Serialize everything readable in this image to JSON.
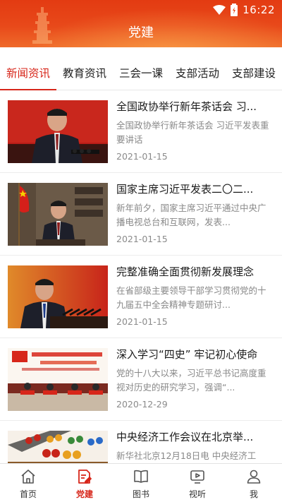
{
  "status_bar": {
    "time": "16:22"
  },
  "header": {
    "title": "党建"
  },
  "tabs": [
    {
      "label": "新闻资讯",
      "active": true
    },
    {
      "label": "教育资讯",
      "active": false
    },
    {
      "label": "三会一课",
      "active": false
    },
    {
      "label": "支部活动",
      "active": false
    },
    {
      "label": "支部建设",
      "active": false
    }
  ],
  "news": [
    {
      "title": "全国政协举行新年茶话会 习...",
      "summary": "全国政协举行新年茶话会 习近平发表重要讲话",
      "date": "2021-01-15"
    },
    {
      "title": "国家主席习近平发表二〇二...",
      "summary": "新年前夕，国家主席习近平通过中央广播电视总台和互联网，发表...",
      "date": "2021-01-15"
    },
    {
      "title": "完整准确全面贯彻新发展理念",
      "summary": "在省部级主要领导干部学习贯彻党的十九届五中全会精神专题研讨...",
      "date": "2021-01-15"
    },
    {
      "title": "深入学习“四史” 牢记初心使命",
      "summary": "党的十八大以来，习近平总书记高度重视对历史的研究学习，强调“...",
      "date": "2020-12-29"
    },
    {
      "title": "中央经济工作会议在北京举...",
      "summary": "新华社北京12月18日电 中央经济工",
      "date": ""
    }
  ],
  "bottom_nav": [
    {
      "label": "首页",
      "icon": "home-icon",
      "active": false
    },
    {
      "label": "党建",
      "icon": "party-building-icon",
      "active": true
    },
    {
      "label": "图书",
      "icon": "book-icon",
      "active": false
    },
    {
      "label": "视听",
      "icon": "video-icon",
      "active": false
    },
    {
      "label": "我",
      "icon": "user-icon",
      "active": false
    }
  ],
  "colors": {
    "accent": "#d7261a",
    "header_top": "#e33b12",
    "header_bottom": "#ef6a2a"
  }
}
